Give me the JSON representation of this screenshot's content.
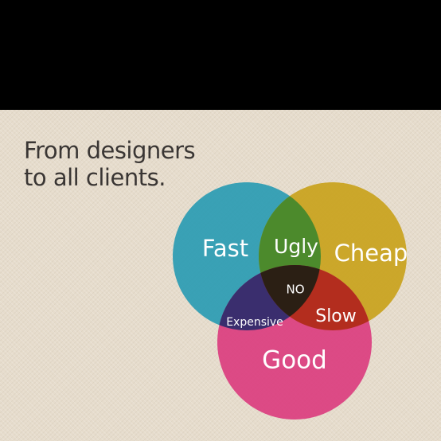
{
  "headline": {
    "line1": "From designers",
    "line2": "to all clients."
  },
  "venn": {
    "sets": [
      {
        "label": "Fast",
        "color": "#2a9bb3"
      },
      {
        "label": "Cheap",
        "color": "#c9a21c"
      },
      {
        "label": "Good",
        "color": "#db3d7f"
      }
    ],
    "intersections": {
      "fast_cheap": {
        "label": "Ugly",
        "color": "#4c8a2c"
      },
      "cheap_good": {
        "label": "Slow",
        "color": "#b32d1e"
      },
      "fast_good": {
        "label": "Expensive",
        "color": "#3a2e6e"
      },
      "all": {
        "label": "NO",
        "color": "#2b1f14"
      }
    }
  },
  "colors": {
    "frame": "#000000",
    "background": "#e6dccc",
    "headline_text": "#3a3634",
    "label_text": "#ffffff"
  }
}
